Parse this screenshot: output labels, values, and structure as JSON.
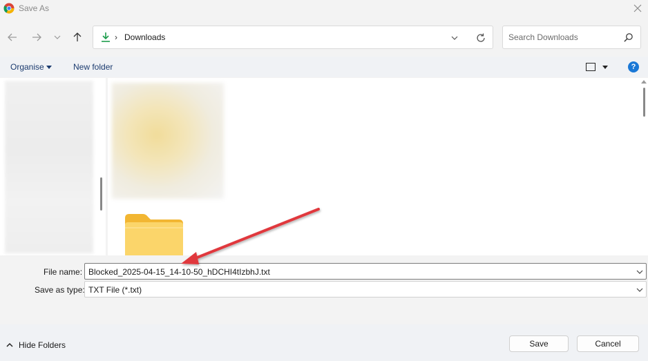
{
  "window": {
    "title": "Save As"
  },
  "navigation": {
    "location": "Downloads",
    "separator": "›"
  },
  "search": {
    "placeholder": "Search Downloads"
  },
  "command_bar": {
    "organise_label": "Organise",
    "new_folder_label": "New folder",
    "help_label": "?"
  },
  "form": {
    "file_name_label": "File name:",
    "file_name_value": "Blocked_2025-04-15_14-10-50_hDCHI4tIzbhJ.txt",
    "save_as_type_label": "Save as type:",
    "save_as_type_value": "TXT File (*.txt)"
  },
  "footer": {
    "hide_folders_label": "Hide Folders",
    "save_label": "Save",
    "cancel_label": "Cancel"
  },
  "colors": {
    "accent_blue": "#1a78d6",
    "link_text": "#1a3a6e",
    "download_green": "#1c9c4b",
    "folder_yellow": "#f7c948",
    "annotation_red": "#e0393e"
  },
  "icons": {
    "app": "chrome-icon",
    "close": "close-icon",
    "back": "back-arrow-icon",
    "forward": "forward-arrow-icon",
    "recent": "chevron-down-icon",
    "up": "up-arrow-icon",
    "download": "download-icon",
    "refresh": "refresh-icon",
    "search": "search-icon",
    "view": "view-mode-icon",
    "help": "help-icon",
    "folder": "folder-icon"
  }
}
